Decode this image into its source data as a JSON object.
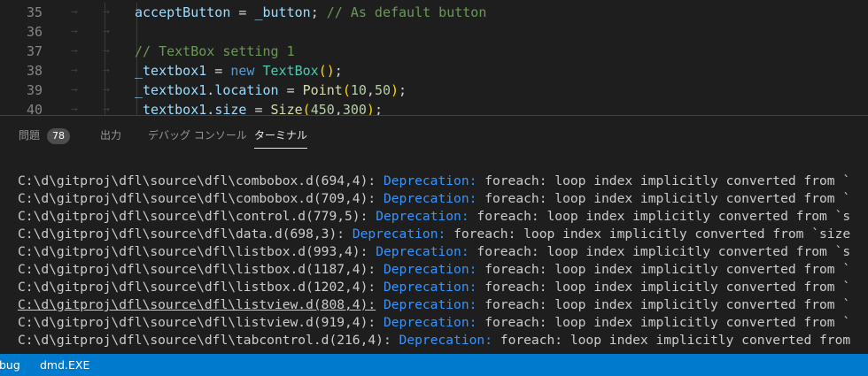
{
  "editor": {
    "lines": [
      {
        "number": "35",
        "tokens": [
          {
            "t": "acceptButton",
            "c": "t-var"
          },
          {
            "t": " = ",
            "c": "t-plain"
          },
          {
            "t": "_button",
            "c": "t-var"
          },
          {
            "t": "; ",
            "c": "t-plain"
          },
          {
            "t": "// As default button",
            "c": "t-com"
          }
        ]
      },
      {
        "number": "36",
        "tokens": []
      },
      {
        "number": "37",
        "tokens": [
          {
            "t": "// TextBox setting 1",
            "c": "t-com"
          }
        ]
      },
      {
        "number": "38",
        "tokens": [
          {
            "t": "_textbox1",
            "c": "t-var"
          },
          {
            "t": " = ",
            "c": "t-plain"
          },
          {
            "t": "new",
            "c": "t-kw"
          },
          {
            "t": " ",
            "c": "t-plain"
          },
          {
            "t": "TextBox",
            "c": "t-type"
          },
          {
            "t": "()",
            "c": "t-paren"
          },
          {
            "t": ";",
            "c": "t-plain"
          }
        ]
      },
      {
        "number": "39",
        "tokens": [
          {
            "t": "_textbox1",
            "c": "t-var"
          },
          {
            "t": ".",
            "c": "t-plain"
          },
          {
            "t": "location",
            "c": "t-var"
          },
          {
            "t": " = ",
            "c": "t-plain"
          },
          {
            "t": "Point",
            "c": "t-fn"
          },
          {
            "t": "(",
            "c": "t-paren"
          },
          {
            "t": "10",
            "c": "t-num"
          },
          {
            "t": ",",
            "c": "t-plain"
          },
          {
            "t": "50",
            "c": "t-num"
          },
          {
            "t": ")",
            "c": "t-paren"
          },
          {
            "t": ";",
            "c": "t-plain"
          }
        ]
      },
      {
        "number": "40",
        "tokens": [
          {
            "t": "_textbox1",
            "c": "t-var"
          },
          {
            "t": ".",
            "c": "t-plain"
          },
          {
            "t": "size",
            "c": "t-var"
          },
          {
            "t": " = ",
            "c": "t-plain"
          },
          {
            "t": "Size",
            "c": "t-fn"
          },
          {
            "t": "(",
            "c": "t-paren"
          },
          {
            "t": "450",
            "c": "t-num"
          },
          {
            "t": ",",
            "c": "t-plain"
          },
          {
            "t": "300",
            "c": "t-num"
          },
          {
            "t": ")",
            "c": "t-paren"
          },
          {
            "t": ";",
            "c": "t-plain"
          }
        ]
      }
    ]
  },
  "panel": {
    "tabs": {
      "problems": "問題",
      "problems_count": "78",
      "output": "出力",
      "debug_console": "デバッグ コンソール",
      "terminal": "ターミナル"
    },
    "terminal_lines": [
      {
        "path": "C:\\d\\gitproj\\dfl\\source\\dfl\\combobox.d(694,4):",
        "level": "Deprecation:",
        "message": "foreach: loop index implicitly converted from `",
        "underlined": false
      },
      {
        "path": "C:\\d\\gitproj\\dfl\\source\\dfl\\combobox.d(709,4):",
        "level": "Deprecation:",
        "message": "foreach: loop index implicitly converted from `",
        "underlined": false
      },
      {
        "path": "C:\\d\\gitproj\\dfl\\source\\dfl\\control.d(779,5):",
        "level": "Deprecation:",
        "message": "foreach: loop index implicitly converted from `s",
        "underlined": false
      },
      {
        "path": "C:\\d\\gitproj\\dfl\\source\\dfl\\data.d(698,3):",
        "level": "Deprecation:",
        "message": "foreach: loop index implicitly converted from `size",
        "underlined": false
      },
      {
        "path": "C:\\d\\gitproj\\dfl\\source\\dfl\\listbox.d(993,4):",
        "level": "Deprecation:",
        "message": "foreach: loop index implicitly converted from `s",
        "underlined": false
      },
      {
        "path": "C:\\d\\gitproj\\dfl\\source\\dfl\\listbox.d(1187,4):",
        "level": "Deprecation:",
        "message": "foreach: loop index implicitly converted from `",
        "underlined": false
      },
      {
        "path": "C:\\d\\gitproj\\dfl\\source\\dfl\\listbox.d(1202,4):",
        "level": "Deprecation:",
        "message": "foreach: loop index implicitly converted from `",
        "underlined": false
      },
      {
        "path": "C:\\d\\gitproj\\dfl\\source\\dfl\\listview.d(808,4):",
        "level": "Deprecation:",
        "message": "foreach: loop index implicitly converted from `",
        "underlined": true
      },
      {
        "path": "C:\\d\\gitproj\\dfl\\source\\dfl\\listview.d(919,4):",
        "level": "Deprecation:",
        "message": "foreach: loop index implicitly converted from `",
        "underlined": false
      },
      {
        "path": "C:\\d\\gitproj\\dfl\\source\\dfl\\tabcontrol.d(216,4):",
        "level": "Deprecation:",
        "message": "foreach: loop index implicitly converted from",
        "underlined": false
      }
    ]
  },
  "statusbar": {
    "debug_label": "bug",
    "task_label": "dmd.EXE"
  },
  "colors": {
    "statusbar": "#007acc",
    "deprecation": "#3794ff",
    "background": "#1e1e1e"
  }
}
